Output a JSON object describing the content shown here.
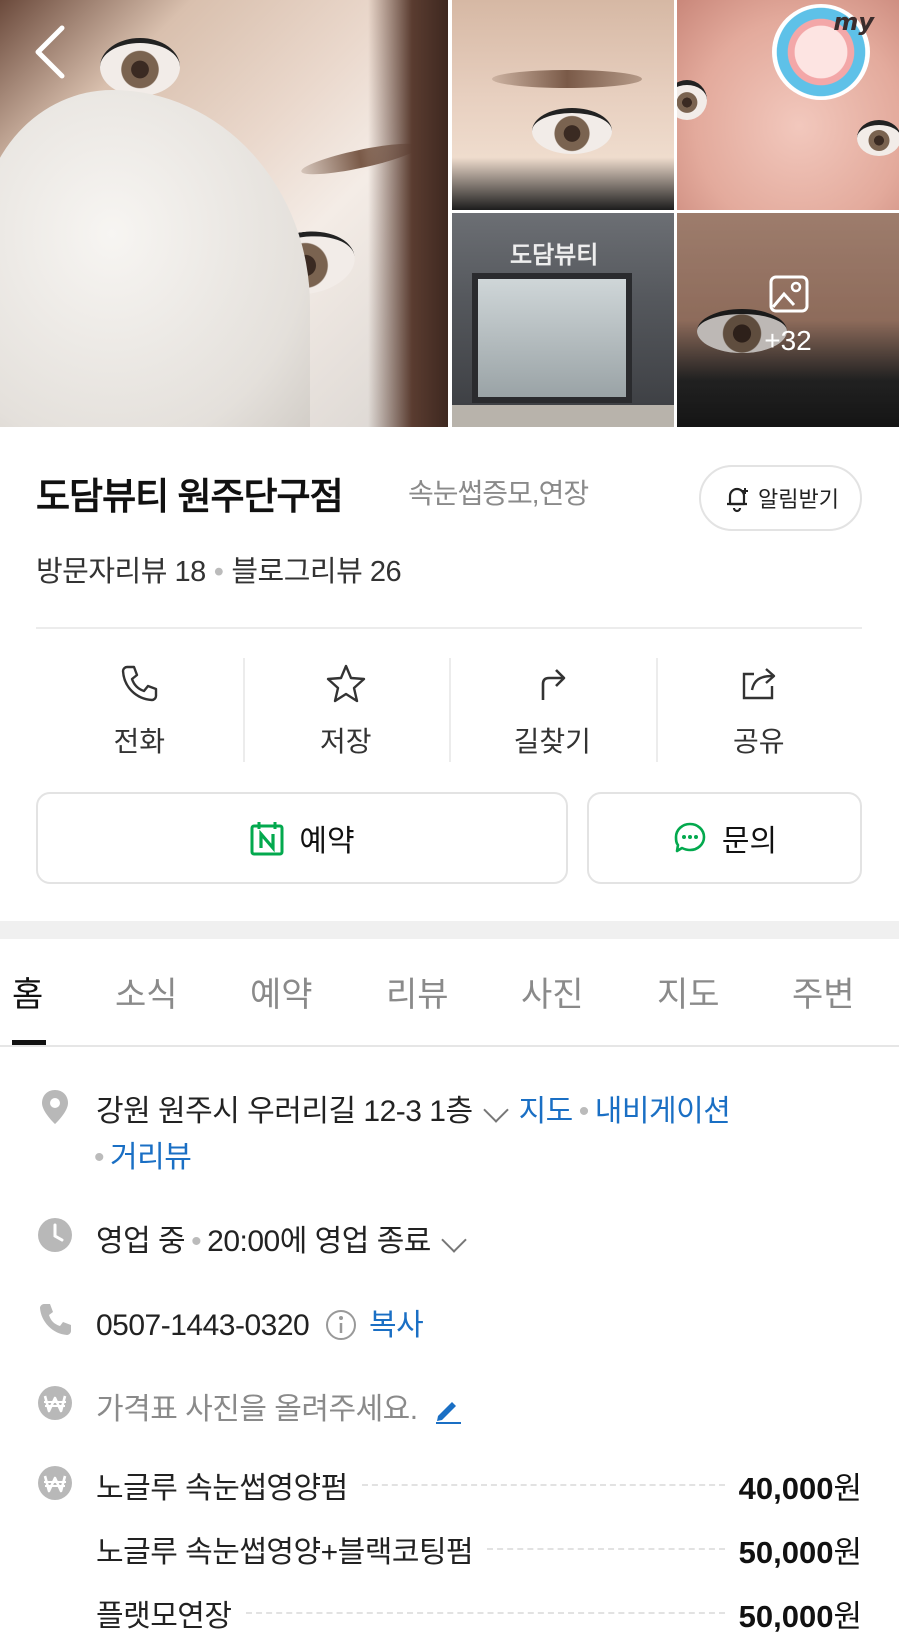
{
  "gallery": {
    "store_sign": "도담뷰티",
    "more_count": "+32",
    "badge_text": "my"
  },
  "place": {
    "name": "도담뷰티 원주단구점",
    "category": "속눈썹증모,연장",
    "notify_label": "알림받기",
    "visitor_reviews": "방문자리뷰 18",
    "blog_reviews": "블로그리뷰 26"
  },
  "actions": [
    {
      "label": "전화",
      "icon": "phone-icon"
    },
    {
      "label": "저장",
      "icon": "star-icon"
    },
    {
      "label": "길찾기",
      "icon": "directions-icon"
    },
    {
      "label": "공유",
      "icon": "share-icon"
    }
  ],
  "buttons": {
    "reserve": "예약",
    "inquiry": "문의",
    "reserve_icon": "naver-calendar-icon",
    "inquiry_icon": "chat-icon",
    "accent_green": "#03a94e"
  },
  "tabs": [
    "홈",
    "소식",
    "예약",
    "리뷰",
    "사진",
    "지도",
    "주변"
  ],
  "active_tab": "홈",
  "info": {
    "address": "강원 원주시 우러리길 12-3 1층",
    "map_link": "지도",
    "navigation_link": "내비게이션",
    "streetview_link": "거리뷰",
    "status": "영업 중",
    "hours": "20:00에 영업 종료",
    "phone": "0507-1443-0320",
    "copy_link": "복사",
    "price_prompt": "가격표 사진을 올려주세요.",
    "link_color": "#1a6fc4"
  },
  "prices": [
    {
      "name": "노글루 속눈썹영양펌",
      "amount": "40,000",
      "unit": "원"
    },
    {
      "name": "노글루 속눈썹영양+블랙코팅펌",
      "amount": "50,000",
      "unit": "원"
    },
    {
      "name": "플랫모연장",
      "amount": "50,000",
      "unit": "원"
    }
  ]
}
